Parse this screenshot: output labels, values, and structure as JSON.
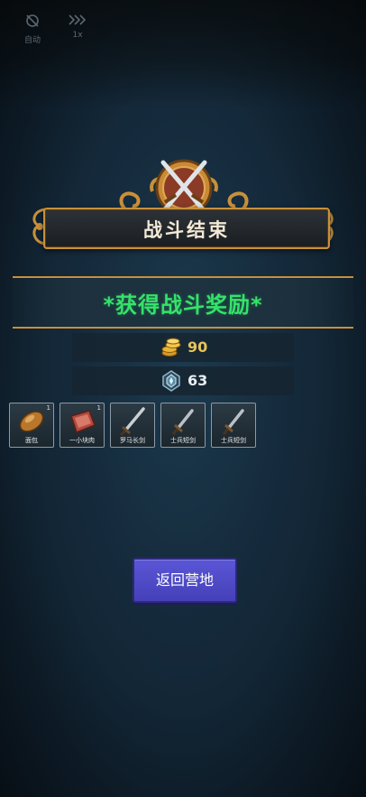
{
  "hud": {
    "auto_label": "自动",
    "speed_label": "1x"
  },
  "header": {
    "title": "战斗结束"
  },
  "rewards": {
    "title": "*获得战斗奖励*",
    "gold": "90",
    "gems": "63"
  },
  "items": [
    {
      "name": "面包",
      "count": "1",
      "icon": "bread-icon"
    },
    {
      "name": "一小块肉",
      "count": "1",
      "icon": "meat-icon"
    },
    {
      "name": "罗马长剑",
      "count": "",
      "icon": "longsword-icon"
    },
    {
      "name": "士兵短剑",
      "count": "",
      "icon": "shortsword-icon"
    },
    {
      "name": "士兵短剑",
      "count": "",
      "icon": "shortsword-icon"
    }
  ],
  "actions": {
    "return_label": "返回营地"
  },
  "colors": {
    "reward_title": "#35e26b",
    "gold": "#e7c45b",
    "button": "#4d48c8",
    "frame_gold": "#c8903a"
  }
}
